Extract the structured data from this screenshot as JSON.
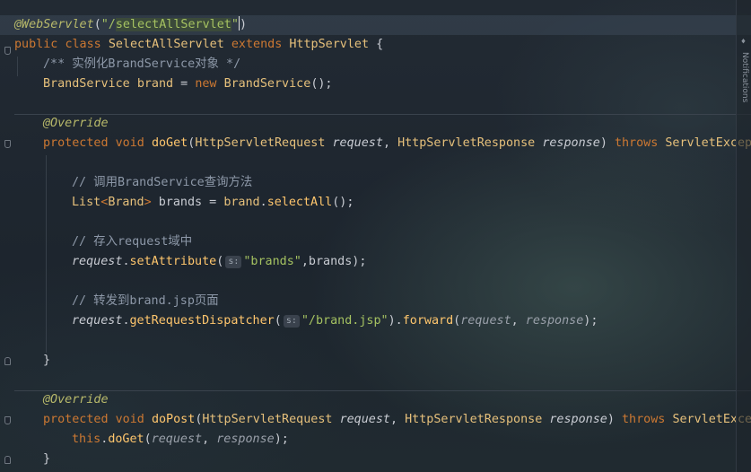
{
  "code": {
    "line1": {
      "ann": "@WebServlet",
      "open": "(",
      "str_q1": "\"/",
      "str_hl": "selectAllServlet",
      "str_q2": "\"",
      "close": ")"
    },
    "line2": {
      "kw1": "public",
      "kw2": "class",
      "cls": "SelectAllServlet",
      "kw3": "extends",
      "sup": "HttpServlet",
      "brace": "{"
    },
    "line3": {
      "comment": "/** 实例化BrandService对象 */"
    },
    "line4": {
      "type": "BrandService",
      "field": "brand",
      "eq": " = ",
      "kw": "new",
      "ctor": "BrandService",
      "end": "();"
    },
    "line6": {
      "ann": "@Override"
    },
    "line7": {
      "kw1": "protected",
      "kw2": "void",
      "fn": "doGet",
      "p1t": "HttpServletRequest",
      "p1": "request",
      "comma": ", ",
      "p2t": "HttpServletResponse",
      "p2": "response",
      "rp": ")",
      "kw3": "throws",
      "exc": "ServletExcep"
    },
    "line9": {
      "comment": "// 调用BrandService查询方法"
    },
    "line10": {
      "type": "List",
      "lt": "<",
      "gen": "Brand",
      "gt": ">",
      "var": "brands",
      "eq": " = ",
      "field": "brand",
      "dot": ".",
      "fn": "selectAll",
      "end": "();"
    },
    "line12": {
      "comment": "// 存入request域中"
    },
    "line13": {
      "param": "request",
      "dot": ".",
      "fn": "setAttribute",
      "lp": "(",
      "hint": "s:",
      "str": "\"brands\"",
      "rest": ",brands);"
    },
    "line15": {
      "comment": "// 转发到brand.jsp页面"
    },
    "line16": {
      "param": "request",
      "dot": ".",
      "fn": "getRequestDispatcher",
      "lp": "(",
      "hint": "s:",
      "str": "\"/brand.jsp\"",
      "rp": ").",
      "fn2": "forward",
      "lp2": "(",
      "a1": "request",
      "comma": ", ",
      "a2": "response",
      "end": ");"
    },
    "line18": {
      "brace": "}"
    },
    "line20": {
      "ann": "@Override"
    },
    "line21": {
      "kw1": "protected",
      "kw2": "void",
      "fn": "doPost",
      "p1t": "HttpServletRequest",
      "p1": "request",
      "comma": ", ",
      "p2t": "HttpServletResponse",
      "p2": "response",
      "rp": ")",
      "kw3": "throws",
      "exc": "ServletExce"
    },
    "line22": {
      "kw": "this",
      "dot": ".",
      "fn": "doGet",
      "lp": "(",
      "a1": "request",
      "comma": ", ",
      "a2": "response",
      "end": ");"
    },
    "line23": {
      "brace": "}"
    }
  },
  "sidebar": {
    "label": "Notifications",
    "icon": "bell-icon"
  },
  "colors": {
    "keyword": "#cc7832",
    "annotation": "#b8b96a",
    "string": "#a5c261",
    "comment": "#8d98a8",
    "method": "#ffc66d",
    "type": "#e6c07b"
  }
}
